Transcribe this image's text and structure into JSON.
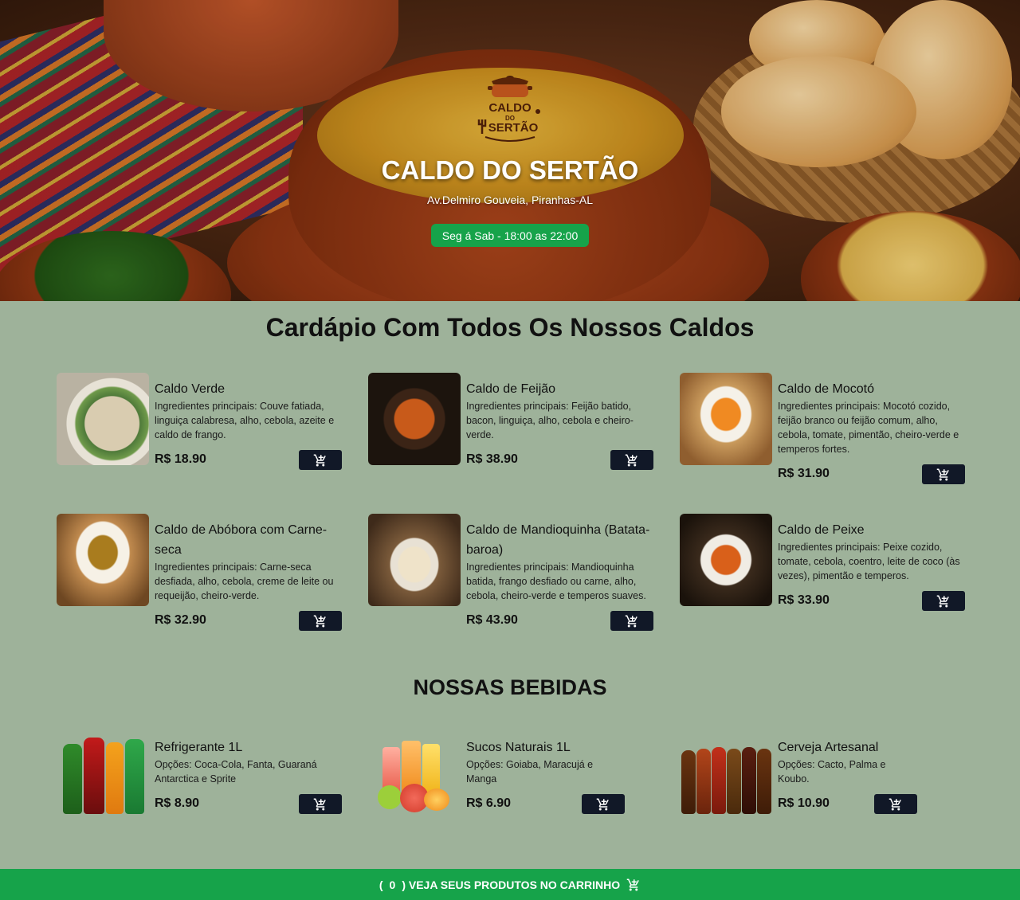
{
  "hero": {
    "logo_text_line1": "CALDO",
    "logo_text_line2": "DO",
    "logo_text_line3": "SERTÃO",
    "title": "CALDO DO SERTÃO",
    "address": "Av.Delmiro Gouveia, Piranhas-AL",
    "hours": "Seg á Sab - 18:00 as 22:00",
    "status_color": "#16a34a"
  },
  "menu": {
    "title": "Cardápio Com Todos Os Nossos Caldos",
    "items": [
      {
        "name": "Caldo Verde",
        "description": "Ingredientes principais: Couve fatiada, linguiça calabresa, alho, cebola, azeite e caldo de frango.",
        "price": "R$ 18.90"
      },
      {
        "name": "Caldo de Feijão",
        "description": "Ingredientes principais: Feijão batido, bacon, linguiça, alho, cebola e cheiro-verde.",
        "price": "R$ 38.90"
      },
      {
        "name": "Caldo de Mocotó",
        "description": "Ingredientes principais: Mocotó cozido, feijão branco ou feijão comum, alho, cebola, tomate, pimentão, cheiro-verde e temperos fortes.",
        "price": "R$ 31.90"
      },
      {
        "name": "Caldo de Abóbora com Carne-seca",
        "description": "Ingredientes principais: Carne-seca desfiada, alho, cebola, creme de leite ou requeijão, cheiro-verde.",
        "price": "R$ 32.90"
      },
      {
        "name": "Caldo de Mandioquinha (Batata-baroa)",
        "description": "Ingredientes principais: Mandioquinha batida, frango desfiado ou carne, alho, cebola, cheiro-verde e temperos suaves.",
        "price": "R$ 43.90"
      },
      {
        "name": "Caldo de Peixe",
        "description": "Ingredientes principais: Peixe cozido, tomate, cebola, coentro, leite de coco (às vezes), pimentão e temperos.",
        "price": "R$ 33.90"
      }
    ]
  },
  "drinks": {
    "title": "NOSSAS BEBIDAS",
    "items": [
      {
        "name": "Refrigerante 1L",
        "description": "Opções: Coca-Cola, Fanta, Guaraná Antarctica e Sprite",
        "price": "R$ 8.90"
      },
      {
        "name": "Sucos Naturais 1L",
        "description": "Opções: Goiaba, Maracujá e Manga",
        "price": "R$ 6.90"
      },
      {
        "name": "Cerveja Artesanal",
        "description": "Opções: Cacto, Palma e Koubo.",
        "price": "R$ 10.90"
      }
    ]
  },
  "icons": {
    "cart": "cart-icon",
    "logo": "pot-icon"
  },
  "cart_bar": {
    "open_paren": "(",
    "count": "0",
    "label": ") VEJA SEUS PRODUTOS NO CARRINHO"
  },
  "colors": {
    "background": "#9eb29a",
    "button_dark": "#111827",
    "accent_green": "#16a34a"
  }
}
